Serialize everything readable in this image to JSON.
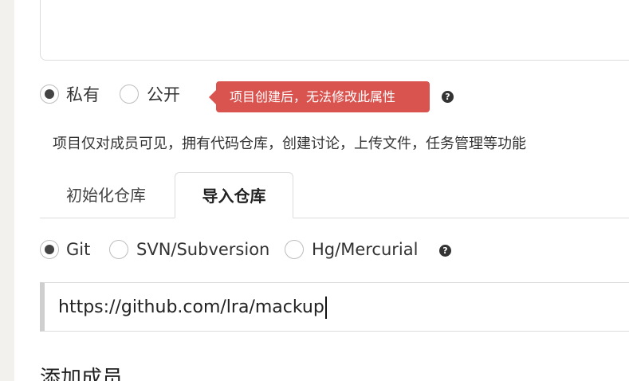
{
  "visibility": {
    "options": [
      {
        "label": "私有",
        "checked": true
      },
      {
        "label": "公开",
        "checked": false
      }
    ],
    "tooltip": "项目创建后，无法修改此属性",
    "help_icon": "question-circle-icon",
    "hint": "项目仅对成员可见，拥有代码仓库，创建讨论，上传文件，任务管理等功能"
  },
  "tabs": [
    {
      "label": "初始化仓库",
      "active": false
    },
    {
      "label": "导入仓库",
      "active": true
    }
  ],
  "vcs": {
    "options": [
      {
        "label": "Git",
        "checked": true
      },
      {
        "label": "SVN/Subversion",
        "checked": false
      },
      {
        "label": "Hg/Mercurial",
        "checked": false
      }
    ],
    "help_icon": "question-circle-icon"
  },
  "import_url": {
    "value": "https://github.com/lra/mackup"
  },
  "members_heading": "添加成员",
  "colors": {
    "tooltip_bg": "#d9534f",
    "sidebar_bg": "#f3f1ee"
  }
}
